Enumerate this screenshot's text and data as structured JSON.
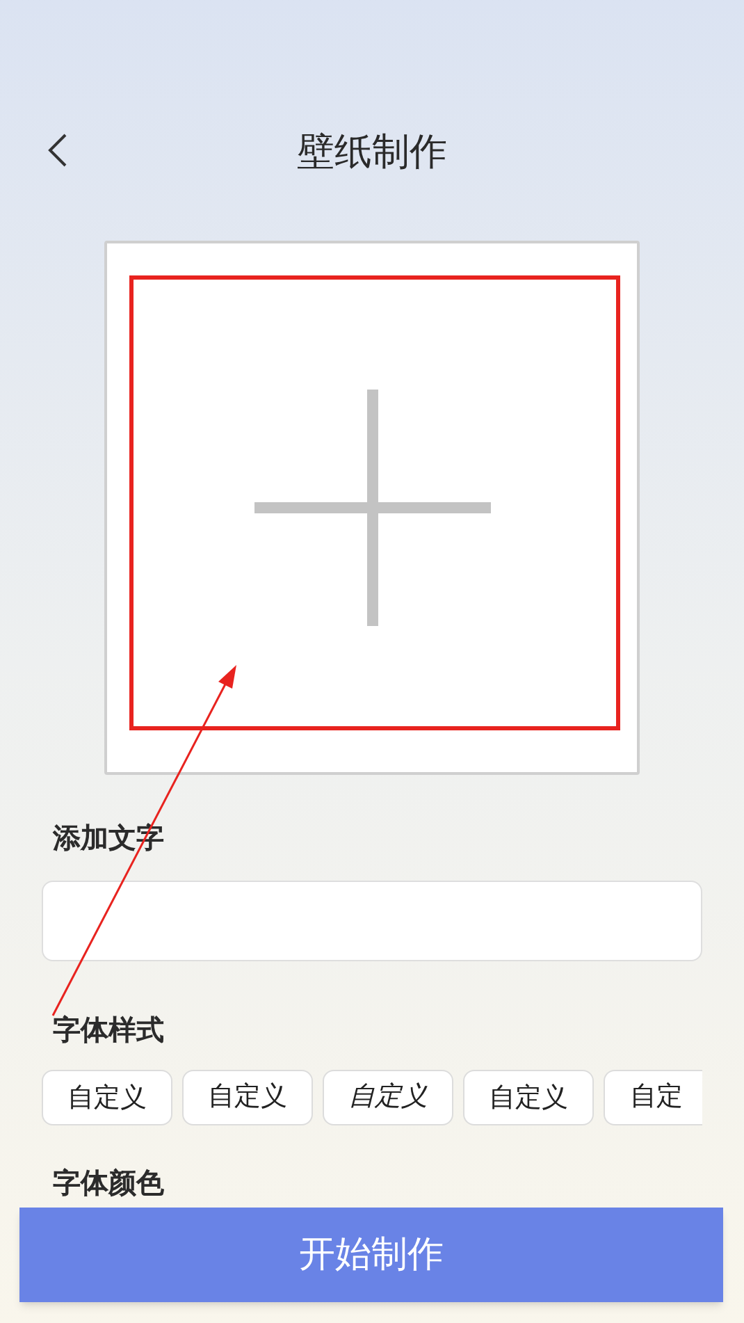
{
  "header": {
    "title": "壁纸制作"
  },
  "sections": [
    {
      "title": "添加文字",
      "kind": "text_input"
    },
    {
      "title": "字体样式",
      "kind": "font_styles",
      "styles": [
        "自定义",
        "自定义",
        "自定义",
        "自定义",
        "自定"
      ]
    },
    {
      "title": "字体颜色",
      "kind": "heading"
    }
  ],
  "action_button": {
    "label": "开始制作"
  }
}
